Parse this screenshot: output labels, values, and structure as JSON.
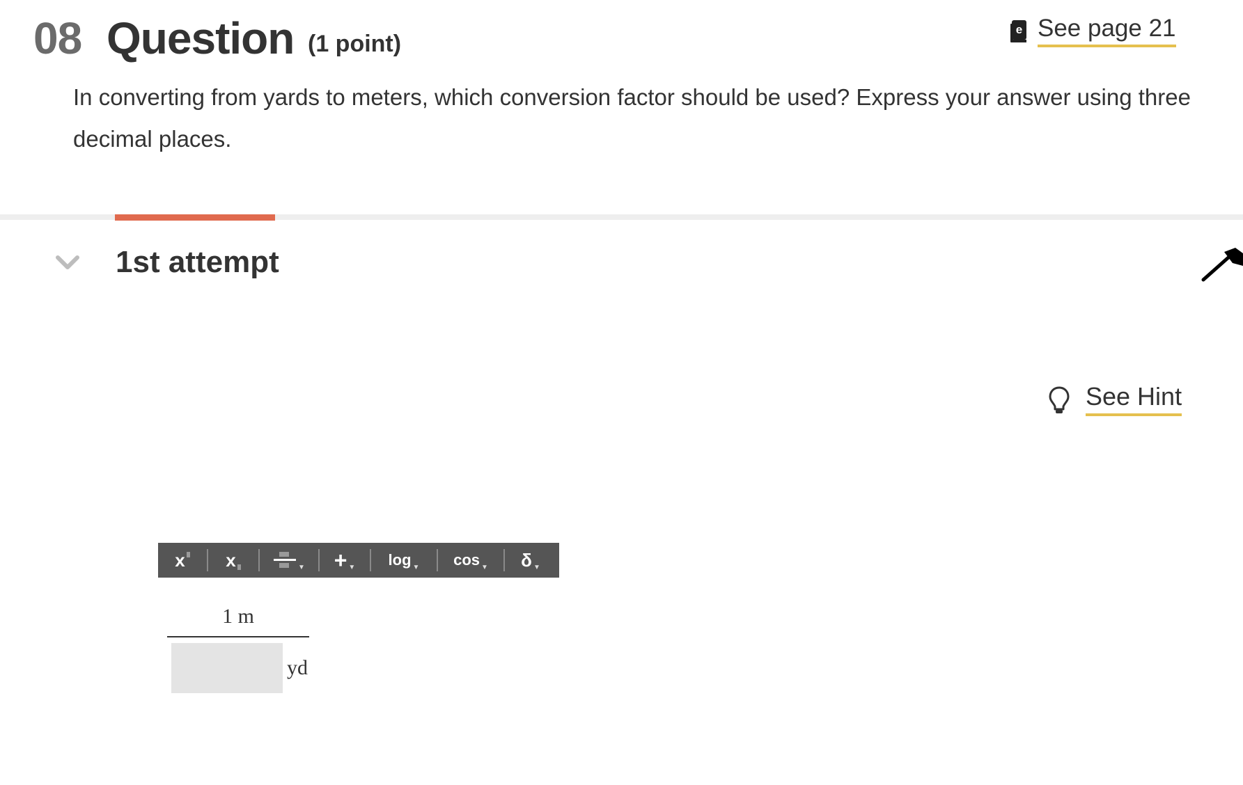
{
  "question": {
    "number": "08",
    "title": "Question",
    "points": "(1 point)",
    "ebook_link_label": "See page 21",
    "prompt": "In converting from yards to meters, which conversion factor should be used? Express your answer using three decimal places."
  },
  "attempt": {
    "title": "1st attempt",
    "hint_label": "See Hint"
  },
  "toolbar": {
    "superscript": "x",
    "subscript": "x",
    "plus": "+",
    "log": "log",
    "cos": "cos",
    "delta": "δ"
  },
  "fraction": {
    "numerator": "1 m",
    "denominator_value": "",
    "denominator_unit": "yd"
  },
  "colors": {
    "accent_underline": "#e5c04e",
    "active_tab": "#e06a4e",
    "toolbar_bg": "#555555",
    "answer_box_bg": "#e4e4e4"
  },
  "icons": {
    "ebook": "ebook-icon",
    "collapse": "chevron-down-icon",
    "hint": "lightbulb-icon",
    "cursor": "cursor-arrow-icon"
  }
}
